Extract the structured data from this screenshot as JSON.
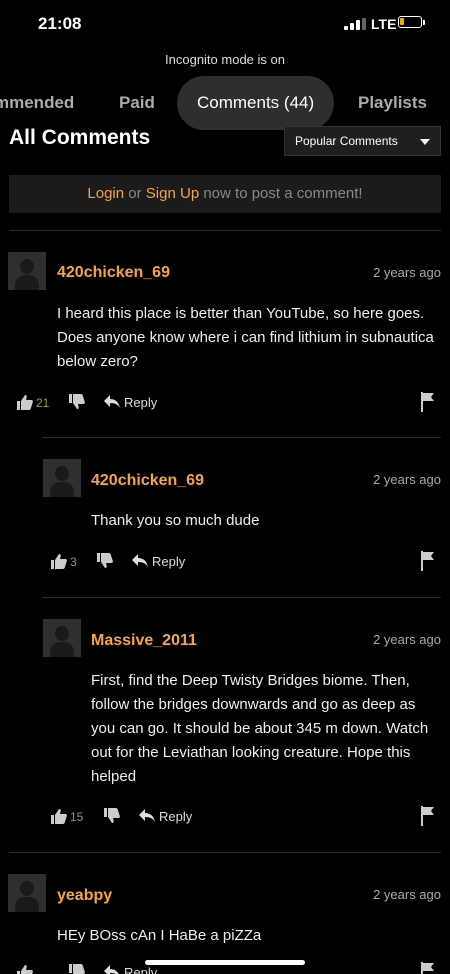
{
  "status": {
    "time": "21:08",
    "network": "LTE"
  },
  "incognito": "Incognito mode is on",
  "tabs": [
    {
      "label": "mmended"
    },
    {
      "label": "Paid"
    },
    {
      "label": "Comments (44)"
    },
    {
      "label": "Playlists"
    }
  ],
  "section_title": "All Comments",
  "sort": {
    "selected": "Popular Comments"
  },
  "login_bar": {
    "login": "Login",
    "or": " or ",
    "signup": "Sign Up",
    "rest": " now to post a comment!"
  },
  "comments": [
    {
      "user": "420chicken_69",
      "time": "2 years ago",
      "text": "I heard this place is better than YouTube, so here goes. Does anyone know where i can find lithium in subnautica below zero?",
      "likes": "21",
      "reply_label": "Reply"
    },
    {
      "user": "420chicken_69",
      "time": "2 years ago",
      "text": "Thank you so much dude",
      "likes": "3",
      "reply_label": "Reply"
    },
    {
      "user": "Massive_2011",
      "time": "2 years ago",
      "text": "First, find the Deep Twisty Bridges biome. Then, follow the bridges downwards and go as deep as you can go. It should be about 345 m down. Watch out for the Leviathan looking creature. Hope this helped",
      "likes": "15",
      "reply_label": "Reply"
    },
    {
      "user": "yeabpy",
      "time": "2 years ago",
      "text": "HEy BOss cAn I HaBe a piZZa",
      "likes": "",
      "reply_label": "Reply"
    }
  ],
  "colors": {
    "accent": "#f7a447",
    "like_count": "#8aa040",
    "background": "#000000"
  }
}
